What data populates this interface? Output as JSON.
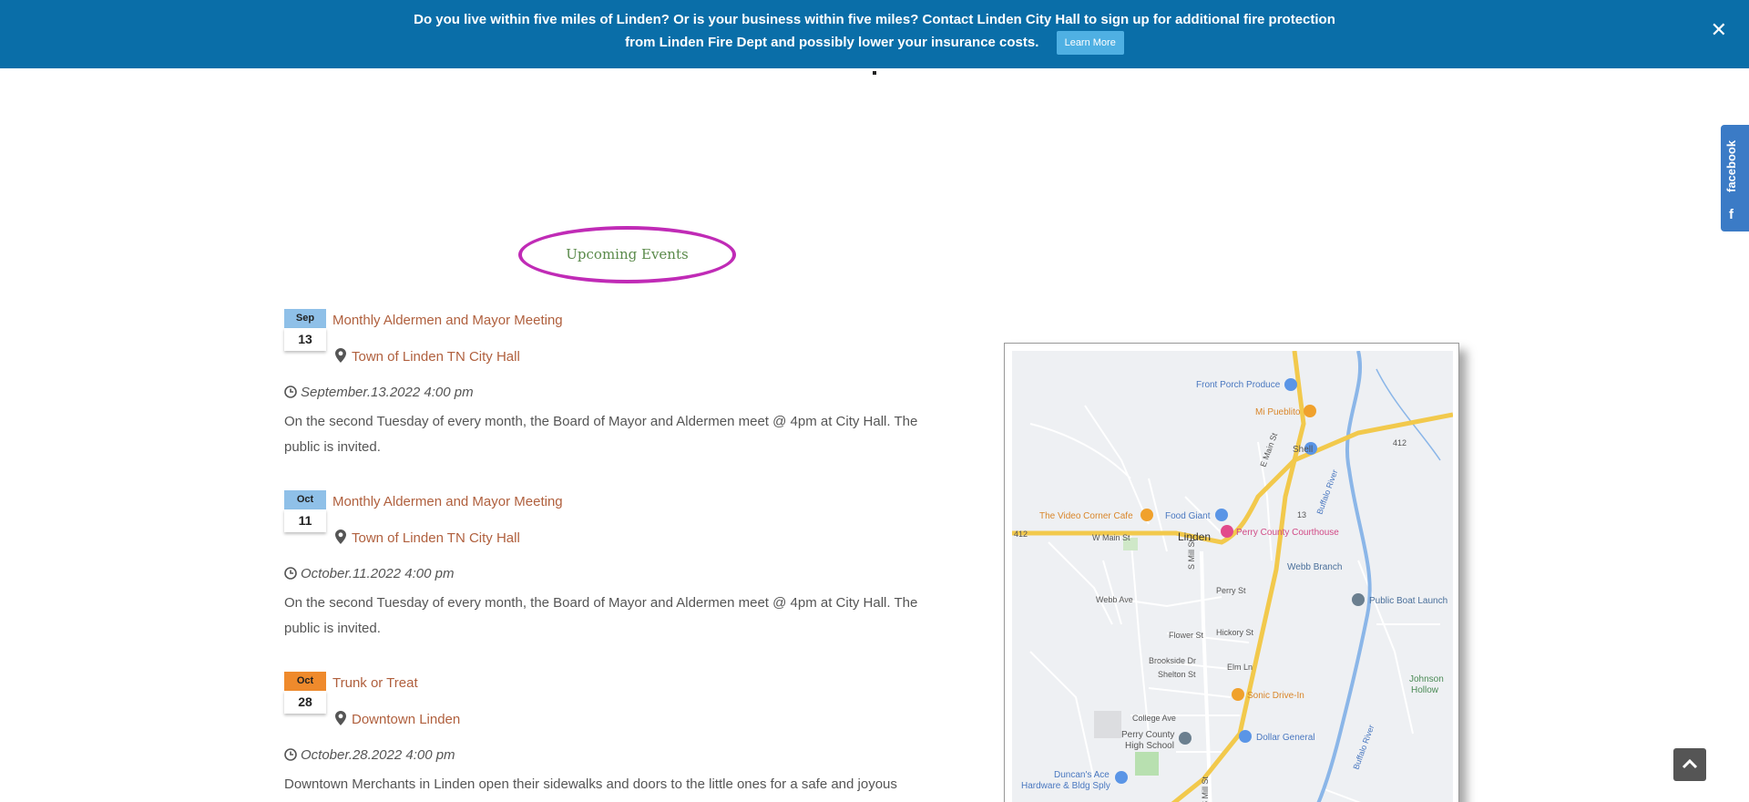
{
  "banner": {
    "line1": "Do you live within five miles of Linden? Or is your business within five miles? Contact Linden City Hall to sign up for additional fire protection",
    "line2": "from Linden Fire Dept and possibly lower your insurance costs.",
    "learn_more": "Learn More",
    "close": "✕"
  },
  "events_heading": "Upcoming Events",
  "events": [
    {
      "month": "Sep",
      "day": "13",
      "month_color": "#8fc0e8",
      "title": "Monthly Aldermen and Mayor Meeting",
      "location": "Town of Linden TN City Hall",
      "time": "September.13.2022 4:00 pm",
      "description": "On the second Tuesday of every month, the Board of Mayor and Aldermen meet @ 4pm at City Hall.  The public is invited."
    },
    {
      "month": "Oct",
      "day": "11",
      "month_color": "#8fc0e8",
      "title": "Monthly Aldermen and Mayor Meeting",
      "location": "Town of Linden TN City Hall",
      "time": "October.11.2022 4:00 pm",
      "description": "On the second Tuesday of every month, the Board of Mayor and Aldermen meet @ 4pm at City Hall.  The public is invited."
    },
    {
      "month": "Oct",
      "day": "28",
      "month_color": "#ef8a2c",
      "title": "Trunk or Treat",
      "location": "Downtown Linden",
      "time": "October.28.2022 4:00 pm",
      "description": "Downtown Merchants in Linden open their sidewalks and doors to the little ones for a safe and joyous"
    }
  ],
  "map": {
    "places": {
      "front_porch": "Front Porch Produce",
      "mi_pueblito": "Mi Pueblito",
      "shell": "Shell",
      "video_corner": "The Video Corner Cafe",
      "food_giant": "Food Giant",
      "courthouse": "Perry County Courthouse",
      "linden": "Linden",
      "webb_branch": "Webb Branch",
      "boat_launch": "Public Boat Launch",
      "johnson_hollow_1": "Johnson",
      "johnson_hollow_2": "Hollow",
      "sonic": "Sonic Drive-In",
      "dollar_general": "Dollar General",
      "high_school_1": "Perry County",
      "high_school_2": "High School",
      "duncans_1": "Duncan's Ace",
      "duncans_2": "Hardware & Bldg Sply"
    },
    "streets": {
      "w_main": "W Main St",
      "e_main": "E Main St",
      "s_mill": "S Mill St",
      "s_mill_2": "S Mill St",
      "webb_ave": "Webb Ave",
      "perry_st": "Perry St",
      "flower_st": "Flower St",
      "hickory_st": "Hickory St",
      "brookside": "Brookside Dr",
      "shelton": "Shelton St",
      "elm_ln": "Elm Ln",
      "college_ave": "College Ave",
      "buffalo_river_1": "Buffalo River",
      "buffalo_river_2": "Buffalo River",
      "route_13": "13",
      "route_412_a": "412",
      "route_412_b": "412"
    }
  },
  "facebook_label": "facebook",
  "facebook_f": "f"
}
